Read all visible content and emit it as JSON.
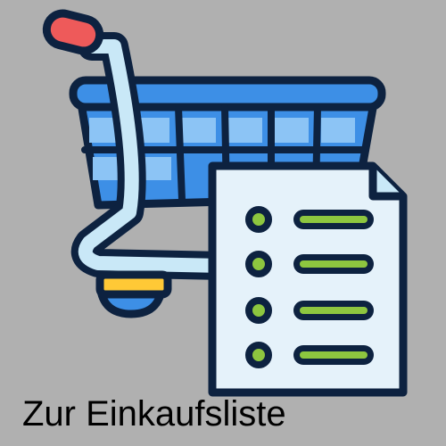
{
  "caption": "Zur Einkaufsliste",
  "icon": "shopping-cart-with-list-icon",
  "colors": {
    "background": "#b0b0b0",
    "outline": "#0d2240",
    "cart_blue": "#3d8fe6",
    "cart_blue_light": "#8cc4f5",
    "handle_red": "#ee5a5a",
    "frame_light": "#c9e8f7",
    "wheel_yellow": "#ffc936",
    "paper": "#e5f2fa",
    "accent_green": "#8dc63f"
  }
}
